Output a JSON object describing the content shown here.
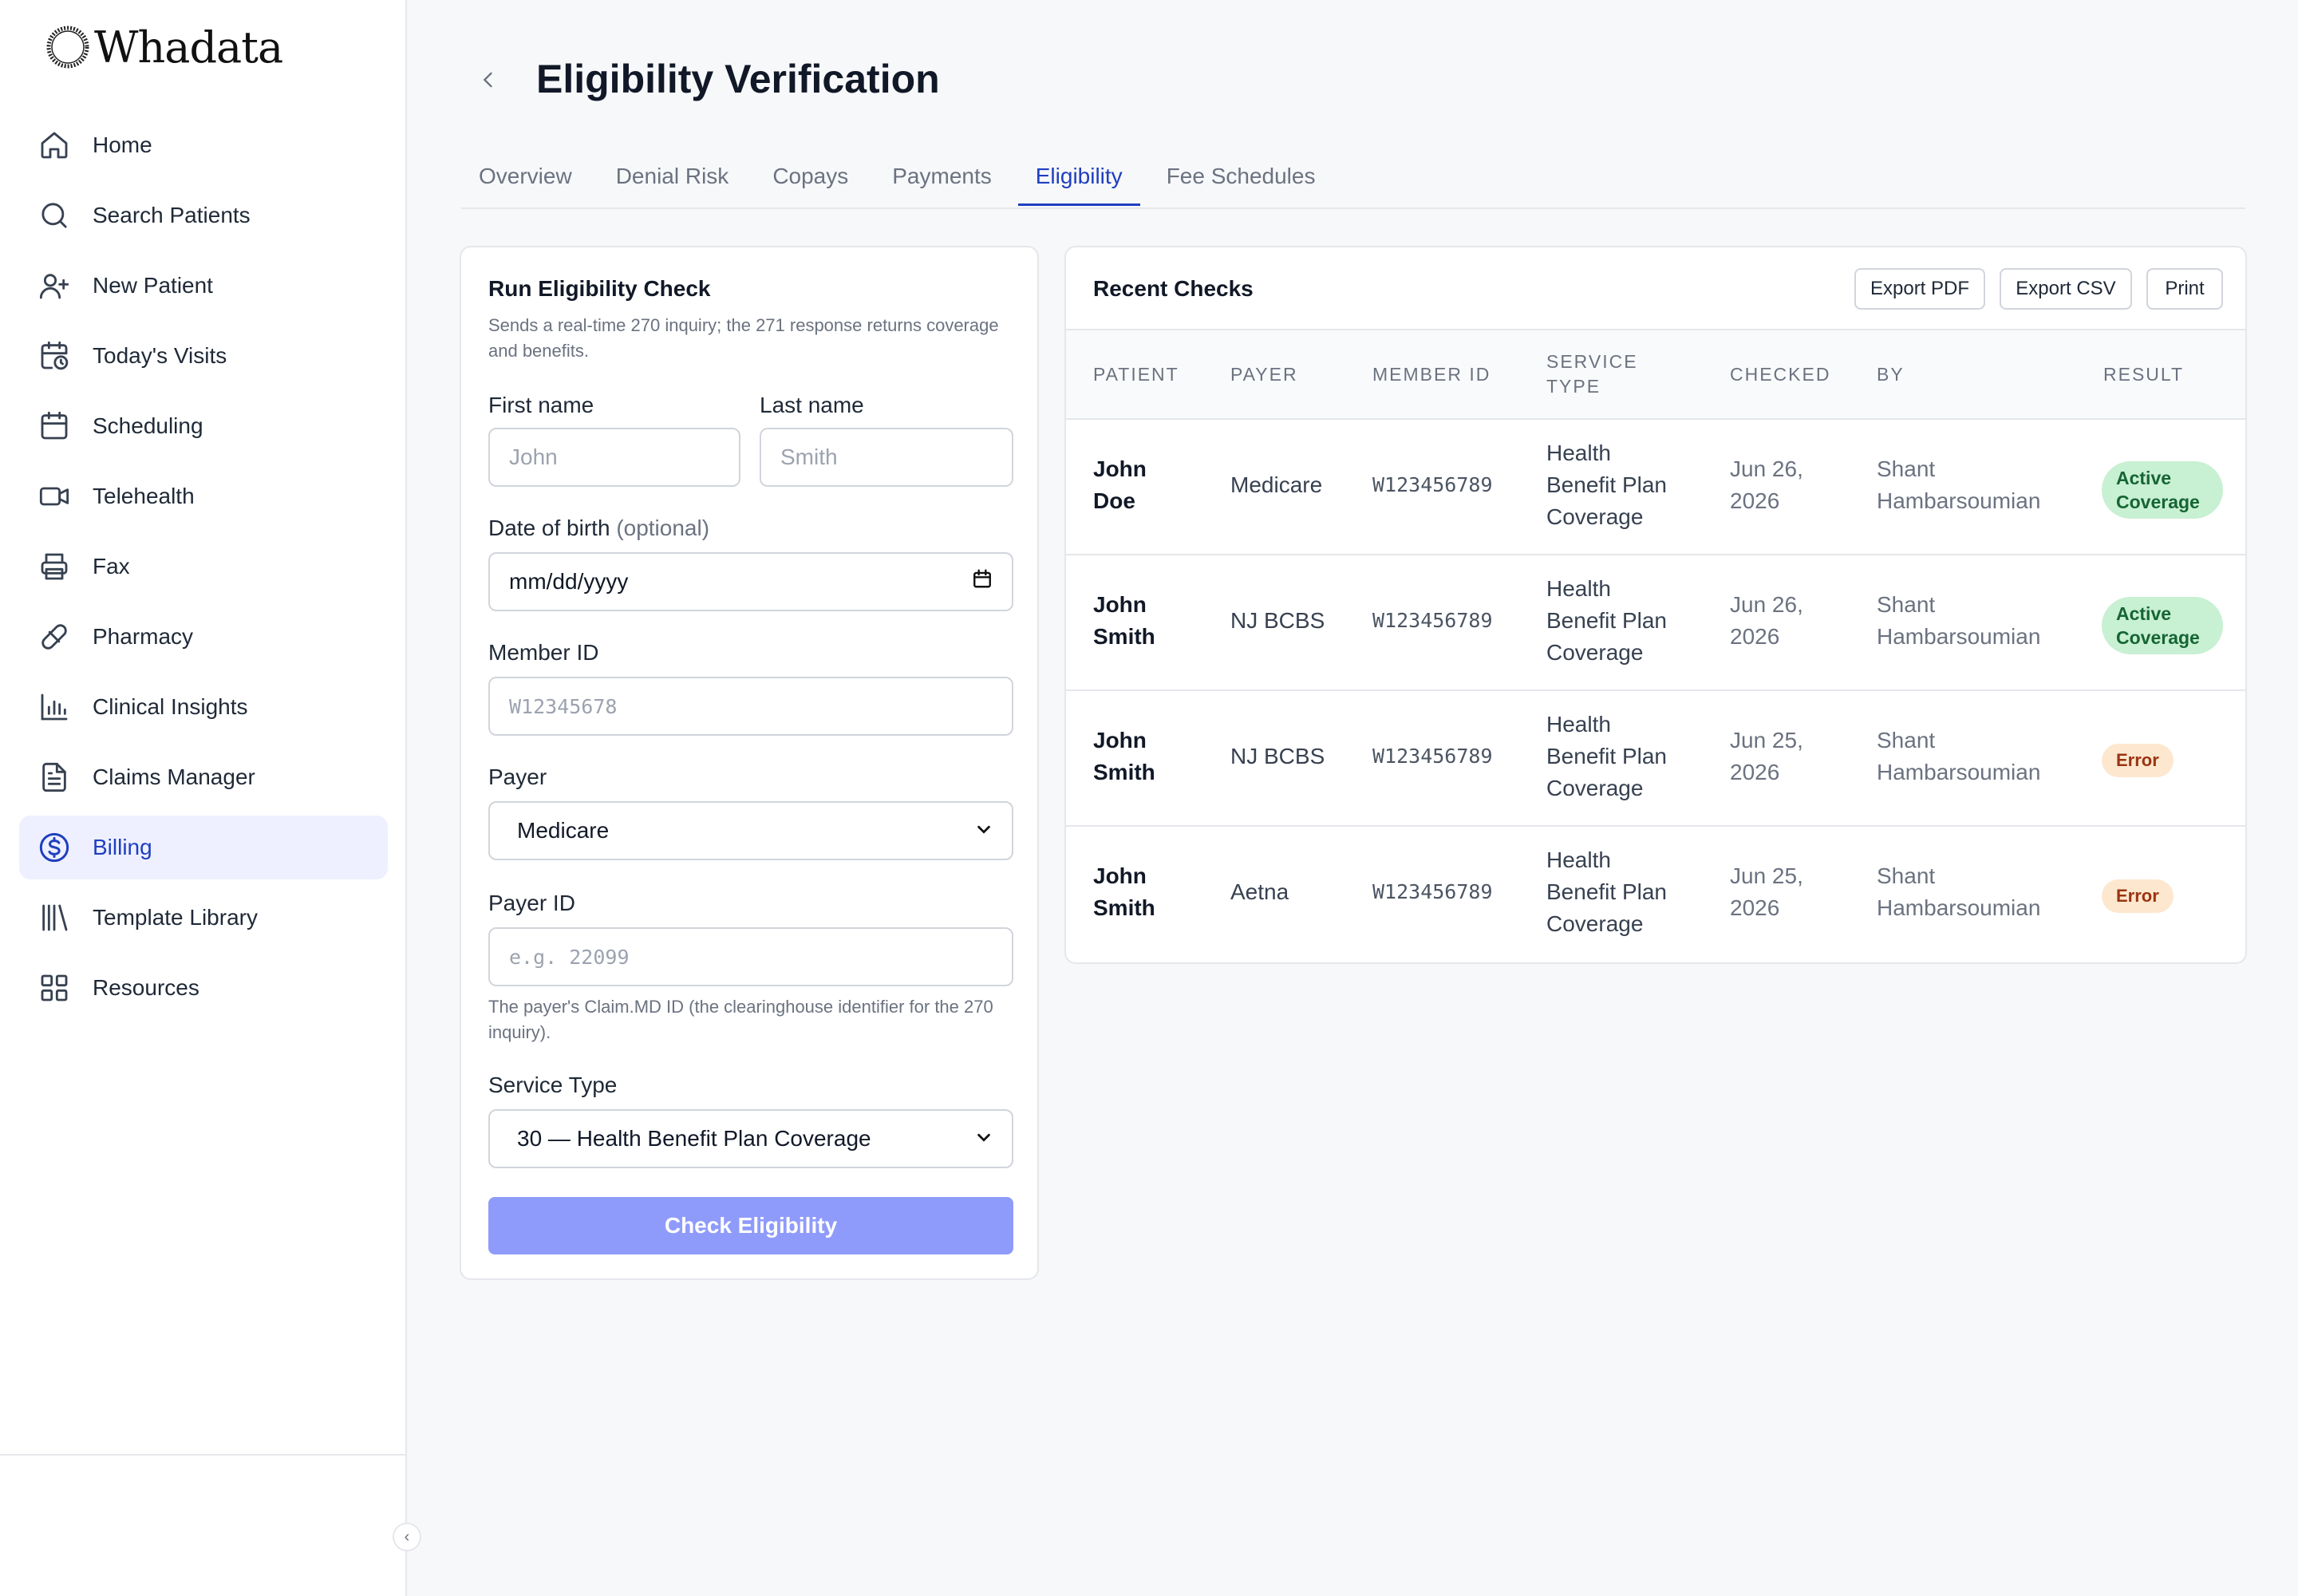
{
  "app": {
    "logo_text": "Whadata"
  },
  "sidebar": {
    "items": [
      {
        "label": "Home",
        "icon": "home-icon"
      },
      {
        "label": "Search Patients",
        "icon": "search-icon"
      },
      {
        "label": "New Patient",
        "icon": "user-plus-icon"
      },
      {
        "label": "Today's Visits",
        "icon": "calendar-clock-icon"
      },
      {
        "label": "Scheduling",
        "icon": "calendar-icon"
      },
      {
        "label": "Telehealth",
        "icon": "video-icon"
      },
      {
        "label": "Fax",
        "icon": "printer-icon"
      },
      {
        "label": "Pharmacy",
        "icon": "pill-icon"
      },
      {
        "label": "Clinical Insights",
        "icon": "bar-chart-icon"
      },
      {
        "label": "Claims Manager",
        "icon": "file-text-icon"
      },
      {
        "label": "Billing",
        "icon": "dollar-circle-icon",
        "active": true
      },
      {
        "label": "Template Library",
        "icon": "library-icon"
      },
      {
        "label": "Resources",
        "icon": "grid-icon"
      }
    ],
    "collapse_glyph": "‹"
  },
  "header": {
    "title": "Eligibility Verification"
  },
  "tabs": [
    {
      "label": "Overview"
    },
    {
      "label": "Denial Risk"
    },
    {
      "label": "Copays"
    },
    {
      "label": "Payments"
    },
    {
      "label": "Eligibility",
      "active": true
    },
    {
      "label": "Fee Schedules"
    }
  ],
  "form": {
    "title": "Run Eligibility Check",
    "subtitle": "Sends a real-time 270 inquiry; the 271 response returns coverage and benefits.",
    "first_name": {
      "label": "First name",
      "placeholder": "John"
    },
    "last_name": {
      "label": "Last name",
      "placeholder": "Smith"
    },
    "dob": {
      "label": "Date of birth",
      "optional": "(optional)",
      "value": "mm/dd/yyyy"
    },
    "member_id": {
      "label": "Member ID",
      "placeholder": "W12345678"
    },
    "payer": {
      "label": "Payer",
      "value": "Medicare"
    },
    "payer_id": {
      "label": "Payer ID",
      "placeholder": "e.g. 22099",
      "hint": "The payer's Claim.MD ID (the clearinghouse identifier for the 270 inquiry)."
    },
    "service_type": {
      "label": "Service Type",
      "value": "30 — Health Benefit Plan Coverage"
    },
    "submit_label": "Check Eligibility"
  },
  "recent": {
    "title": "Recent Checks",
    "buttons": {
      "export_pdf": "Export PDF",
      "export_csv": "Export CSV",
      "print": "Print"
    },
    "columns": [
      "PATIENT",
      "PAYER",
      "MEMBER ID",
      "SERVICE TYPE",
      "CHECKED",
      "BY",
      "RESULT"
    ],
    "rows": [
      {
        "patient": "John Doe",
        "payer": "Medicare",
        "member_id": "W123456789",
        "service_type": "Health Benefit Plan Coverage",
        "checked": "Jun 26, 2026",
        "by": "Shant Hambarsoumian",
        "result": "Active Coverage",
        "status": "ok"
      },
      {
        "patient": "John Smith",
        "payer": "NJ BCBS",
        "member_id": "W123456789",
        "service_type": "Health Benefit Plan Coverage",
        "checked": "Jun 26, 2026",
        "by": "Shant Hambarsoumian",
        "result": "Active Coverage",
        "status": "ok"
      },
      {
        "patient": "John Smith",
        "payer": "NJ BCBS",
        "member_id": "W123456789",
        "service_type": "Health Benefit Plan Coverage",
        "checked": "Jun 25, 2026",
        "by": "Shant Hambarsoumian",
        "result": "Error",
        "status": "err"
      },
      {
        "patient": "John Smith",
        "payer": "Aetna",
        "member_id": "W123456789",
        "service_type": "Health Benefit Plan Coverage",
        "checked": "Jun 25, 2026",
        "by": "Shant Hambarsoumian",
        "result": "Error",
        "status": "err"
      }
    ]
  },
  "colors": {
    "accent": "#1f3fbf",
    "button_primary": "#8f9bfb",
    "active_bg": "#eef0ff",
    "ok_badge": "#c8f0d3",
    "err_badge": "#fde8cf"
  }
}
